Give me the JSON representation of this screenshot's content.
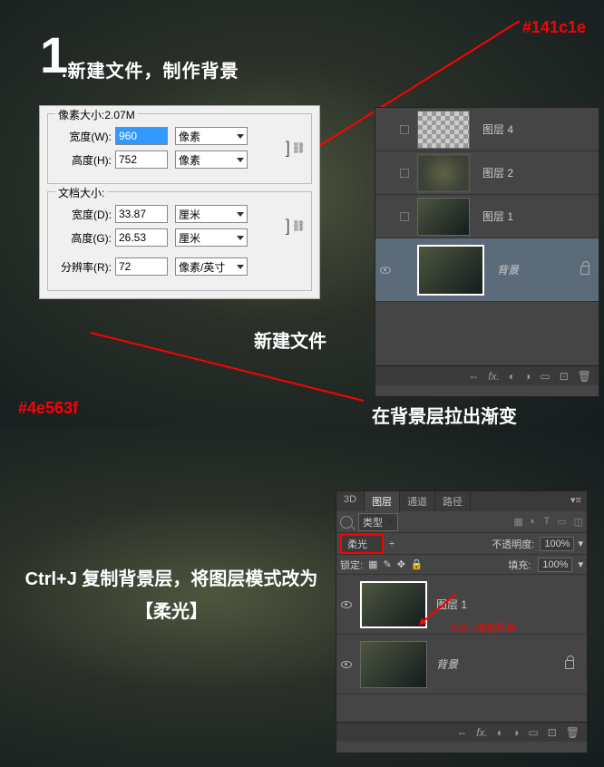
{
  "step": {
    "number": "1",
    "title": ".新建文件，制作背景"
  },
  "colors": {
    "dark": "#141c1e",
    "light": "#4e563f"
  },
  "dialog": {
    "pixel_size_label": "像素大小:2.07M",
    "doc_size_label": "文档大小:",
    "width_label": "宽度(W):",
    "height_label": "高度(H):",
    "width_d_label": "宽度(D):",
    "height_g_label": "高度(G):",
    "res_label": "分辨率(R):",
    "width_val": "960",
    "height_val": "752",
    "width_d_val": "33.87",
    "height_g_val": "26.53",
    "res_val": "72",
    "unit_px": "像素",
    "unit_cm": "厘米",
    "unit_ppi": "像素/英寸"
  },
  "labels": {
    "newfile": "新建文件",
    "gradient": "在背景层拉出渐变"
  },
  "layers1": {
    "l4": "图层 4",
    "l2": "图层 2",
    "l1": "图层 1",
    "bg": "背景"
  },
  "bottom": {
    "instruction": "Ctrl+J 复制背景层，将图层模式改为【柔光】",
    "copy_note": "Ctrl+J复制图层"
  },
  "panel2": {
    "tab_3d": "3D",
    "tab_layers": "图层",
    "tab_channels": "通道",
    "tab_paths": "路径",
    "kind": "类型",
    "blend": "柔光",
    "opacity_label": "不透明度:",
    "opacity_val": "100%",
    "lock_label": "锁定:",
    "fill_label": "填充:",
    "fill_val": "100%",
    "layer1": "图层 1",
    "bg": "背景"
  }
}
